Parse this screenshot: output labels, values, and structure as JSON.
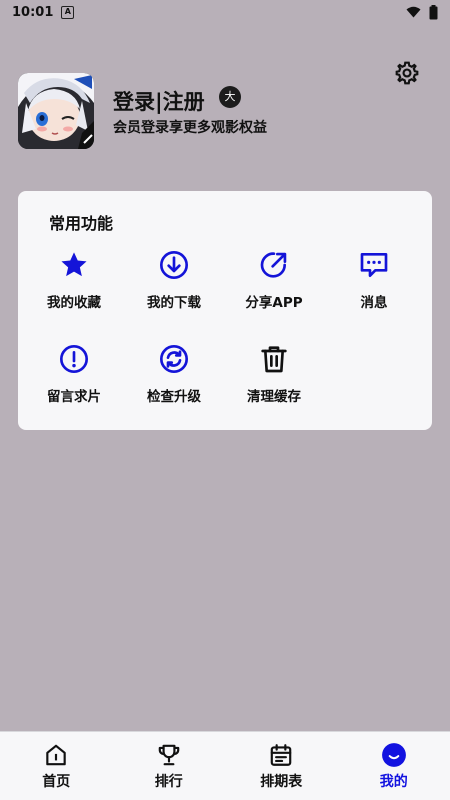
{
  "status_bar": {
    "time": "10:01",
    "sim_icon": "A"
  },
  "header": {
    "settings_icon": "gear-icon",
    "login_label": "登录|注册",
    "vip_badge": "大",
    "subtitle": "会员登录享更多观影权益"
  },
  "functions": {
    "title": "常用功能",
    "items": [
      {
        "label": "我的收藏",
        "icon": "star-icon"
      },
      {
        "label": "我的下载",
        "icon": "download-icon"
      },
      {
        "label": "分享APP",
        "icon": "share-icon"
      },
      {
        "label": "消息",
        "icon": "message-icon"
      },
      {
        "label": "留言求片",
        "icon": "alert-icon"
      },
      {
        "label": "检查升级",
        "icon": "refresh-icon"
      },
      {
        "label": "清理缓存",
        "icon": "trash-icon"
      }
    ]
  },
  "tabbar": {
    "tabs": [
      {
        "label": "首页",
        "icon": "home-icon"
      },
      {
        "label": "排行",
        "icon": "trophy-icon"
      },
      {
        "label": "排期表",
        "icon": "calendar-icon"
      },
      {
        "label": "我的",
        "icon": "profile-icon",
        "active": true
      }
    ]
  },
  "colors": {
    "accent": "#1212e0",
    "background": "#b8b0b8",
    "card": "#f7f7f9"
  }
}
